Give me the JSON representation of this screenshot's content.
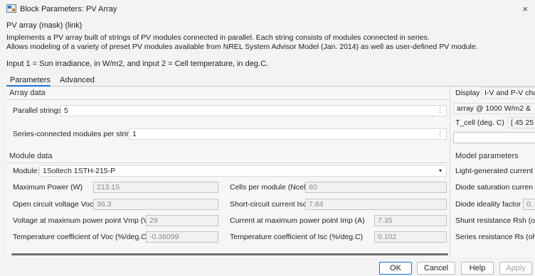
{
  "window": {
    "title": "Block Parameters: PV Array",
    "close_label": "×"
  },
  "header": {
    "block_name": "PV array (mask) (link)",
    "description_line1": "Implements a PV array built of strings of PV modules connected in parallel. Each string consists of modules connected in series.",
    "description_line2": "Allows modeling of a variety of preset PV modules available from NREL System Advisor Model (Jan. 2014) as well as user-defined PV module.",
    "inputs_note": "Input 1 = Sun irradiance, in W/m2, and input 2 = Cell temperature, in deg.C."
  },
  "tabs": [
    {
      "label": "Parameters"
    },
    {
      "label": "Advanced"
    }
  ],
  "array_data": {
    "title": "Array data",
    "parallel_strings": {
      "label": "Parallel strings",
      "value": "5"
    },
    "series_modules": {
      "label": "Series-connected modules per string",
      "value": "1"
    }
  },
  "module_data": {
    "title": "Module data",
    "module": {
      "label": "Module:",
      "value": "1Soltech 1STH-215-P"
    },
    "max_power": {
      "label": "Maximum Power (W)",
      "value": "213.15"
    },
    "cells_per_module": {
      "label": "Cells per module (Ncell)",
      "value": "60"
    },
    "voc": {
      "label": "Open circuit voltage  Voc (V)",
      "value": "36.3"
    },
    "isc": {
      "label": "Short-circuit current Isc (A)",
      "value": "7.84"
    },
    "vmp": {
      "label": "Voltage at maximum power point Vmp (V)",
      "value": "29"
    },
    "imp": {
      "label": "Current at maximum power point Imp (A)",
      "value": "7.35"
    },
    "temp_coef_voc": {
      "label": "Temperature coefficient of Voc (%/deg.C)",
      "value": "-0.36099"
    },
    "temp_coef_isc": {
      "label": "Temperature coefficient of Isc (%/deg.C)",
      "value": "0.102"
    }
  },
  "display": {
    "label": "Display",
    "select_value": "I-V and P-V cha",
    "array_line": "array @ 1000 W/m2 &",
    "tcell_label": "T_cell (deg. C)",
    "tcell_value": "[ 45 25"
  },
  "model_parameters": {
    "title": "Model parameters",
    "items": [
      "Light-generated current",
      "Diode saturation curren",
      "Diode ideality factor",
      "Shunt resistance Rsh (o",
      "Series resistance Rs (oh"
    ],
    "ideality_value": "0."
  },
  "buttons": {
    "ok": "OK",
    "cancel": "Cancel",
    "help": "Help",
    "apply": "Apply"
  },
  "icons": {
    "kebab": "⋮",
    "caret": "▾"
  }
}
